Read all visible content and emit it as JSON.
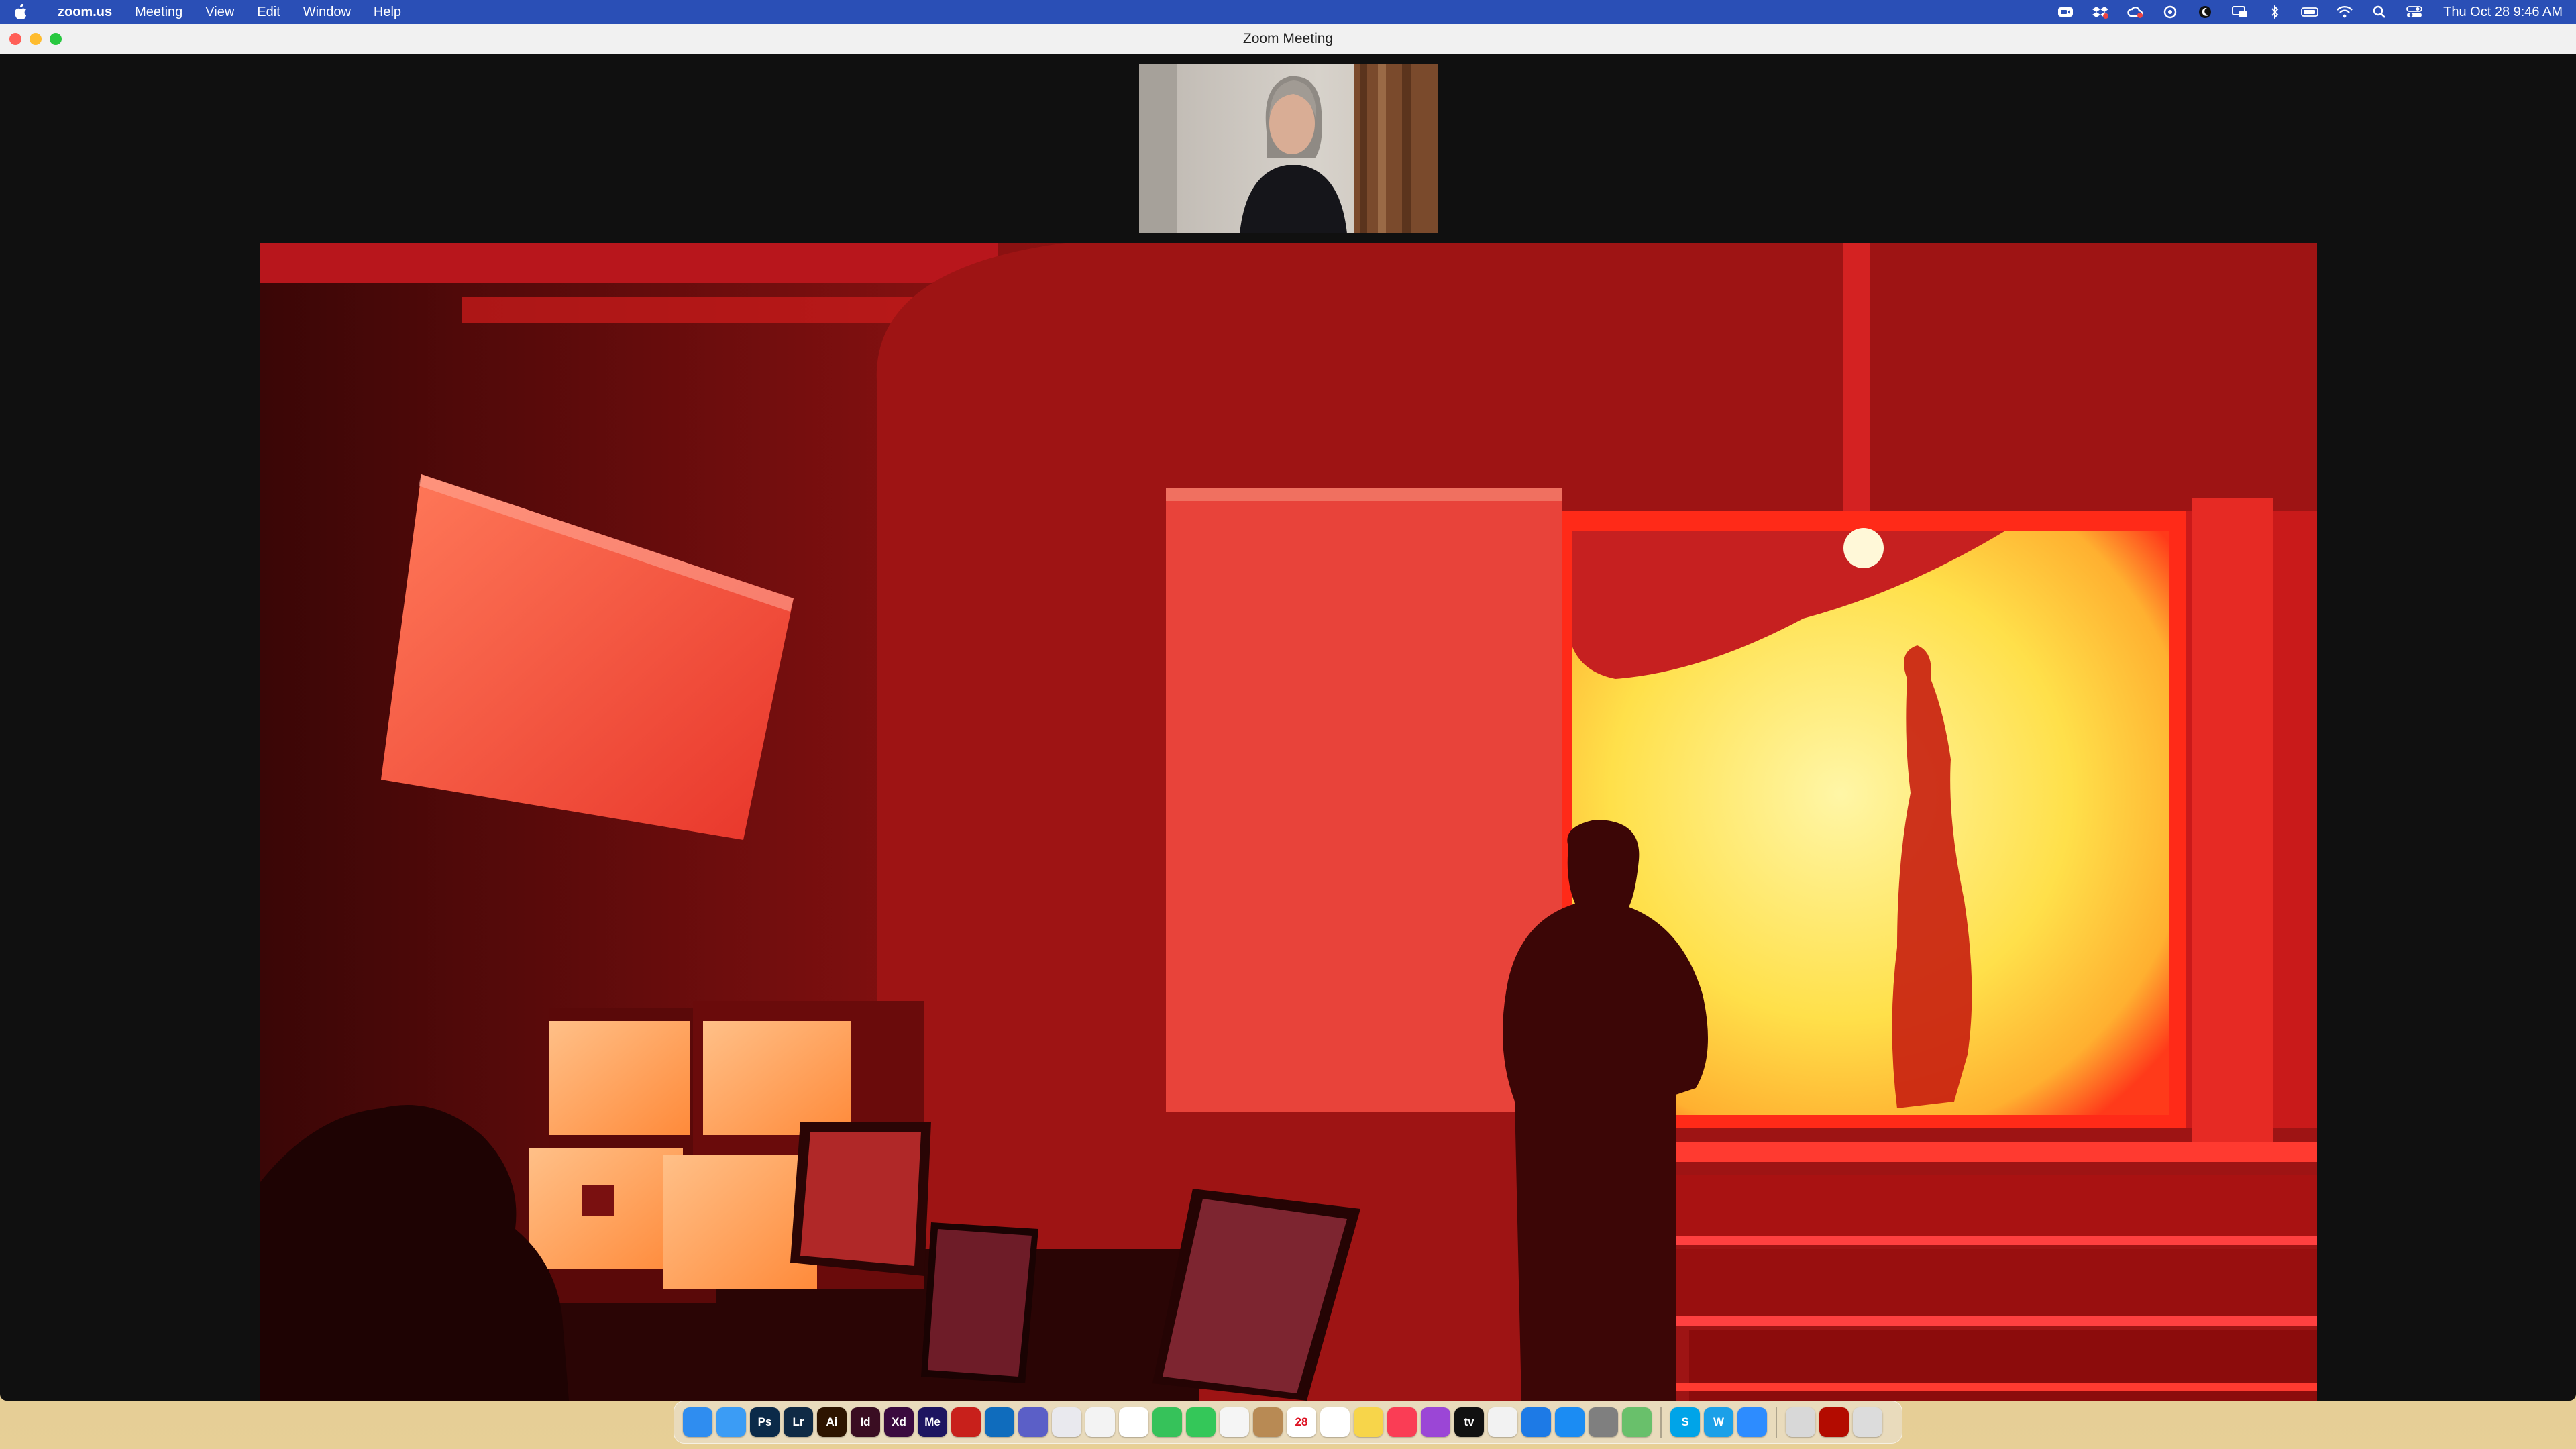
{
  "menubar": {
    "app_name": "zoom.us",
    "items": [
      "Meeting",
      "View",
      "Edit",
      "Window",
      "Help"
    ],
    "clock": "Thu Oct 28  9:46 AM",
    "status_icons": [
      "zoom-status-icon",
      "dropbox-icon",
      "creative-cloud-icon",
      "sync-icon",
      "moon-icon",
      "screen-mirroring-icon",
      "bluetooth-icon",
      "battery-icon",
      "wifi-icon",
      "spotlight-search-icon",
      "control-center-icon"
    ]
  },
  "window": {
    "title": "Zoom Meeting",
    "background_color": "#101010"
  },
  "dock": {
    "apps": [
      {
        "name": "finder-icon",
        "label": "",
        "color": "#2f8df0"
      },
      {
        "name": "safari-icon",
        "label": "",
        "color": "#3b9cf5"
      },
      {
        "name": "photoshop-icon",
        "label": "Ps",
        "color": "#0b2a49"
      },
      {
        "name": "lightroom-icon",
        "label": "Lr",
        "color": "#0f2a45"
      },
      {
        "name": "illustrator-icon",
        "label": "Ai",
        "color": "#2d1400"
      },
      {
        "name": "indesign-icon",
        "label": "Id",
        "color": "#3a0d22"
      },
      {
        "name": "xd-icon",
        "label": "Xd",
        "color": "#3a0a3f"
      },
      {
        "name": "media-encoder-icon",
        "label": "Me",
        "color": "#1d1560"
      },
      {
        "name": "acrobat-icon",
        "label": "",
        "color": "#c8201b"
      },
      {
        "name": "outlook-icon",
        "label": "",
        "color": "#0f6cbd"
      },
      {
        "name": "teams-icon",
        "label": "",
        "color": "#5b5fc7"
      },
      {
        "name": "launchpad-icon",
        "label": "",
        "color": "#e9e9ee"
      },
      {
        "name": "chrome-icon",
        "label": "",
        "color": "#f3f3f3"
      },
      {
        "name": "slack-icon",
        "label": "",
        "color": "#ffffff"
      },
      {
        "name": "facetime-icon",
        "label": "",
        "color": "#36c25a"
      },
      {
        "name": "messages-icon",
        "label": "",
        "color": "#34c759"
      },
      {
        "name": "photos-icon",
        "label": "",
        "color": "#f5f5f5"
      },
      {
        "name": "contacts-icon",
        "label": "",
        "color": "#b88a54"
      },
      {
        "name": "calendar-icon",
        "label": "28",
        "color": "#ffffff"
      },
      {
        "name": "reminders-icon",
        "label": "",
        "color": "#ffffff"
      },
      {
        "name": "notes-icon",
        "label": "",
        "color": "#f7d54a"
      },
      {
        "name": "music-icon",
        "label": "",
        "color": "#fa3d55"
      },
      {
        "name": "podcasts-icon",
        "label": "",
        "color": "#9b46d6"
      },
      {
        "name": "tv-icon",
        "label": "tv",
        "color": "#111111"
      },
      {
        "name": "news-icon",
        "label": "",
        "color": "#f2f2f2"
      },
      {
        "name": "keynote-icon",
        "label": "",
        "color": "#1d7ae6"
      },
      {
        "name": "app-store-icon",
        "label": "",
        "color": "#1b8cf3"
      },
      {
        "name": "system-preferences-icon",
        "label": "",
        "color": "#7f7f7f"
      },
      {
        "name": "maps-icon",
        "label": "",
        "color": "#69c06b"
      },
      {
        "name": "skype-icon",
        "label": "S",
        "color": "#00a4e8"
      },
      {
        "name": "webex-icon",
        "label": "W",
        "color": "#1ba0e8"
      },
      {
        "name": "zoom-icon",
        "label": "",
        "color": "#2d8cff"
      },
      {
        "name": "printer-icon",
        "label": "",
        "color": "#d8d8d8"
      },
      {
        "name": "acrobat-reader-icon",
        "label": "",
        "color": "#b30b00"
      },
      {
        "name": "trash-icon",
        "label": "",
        "color": "#dcdcdc"
      }
    ]
  }
}
